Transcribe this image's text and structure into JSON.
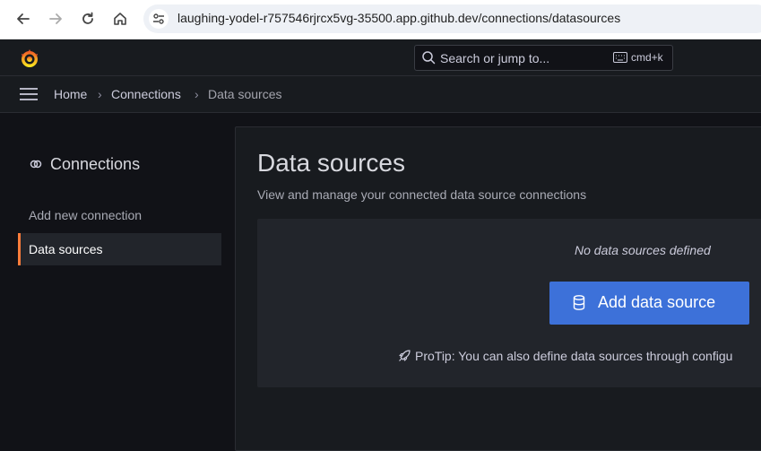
{
  "browser": {
    "url": "laughing-yodel-r757546rjrcx5vg-35500.app.github.dev/connections/datasources"
  },
  "topbar": {
    "search_placeholder": "Search or jump to...",
    "shortcut": "cmd+k"
  },
  "breadcrumb": {
    "items": [
      "Home",
      "Connections",
      "Data sources"
    ]
  },
  "sidebar": {
    "title": "Connections",
    "items": [
      {
        "label": "Add new connection",
        "active": false
      },
      {
        "label": "Data sources",
        "active": true
      }
    ]
  },
  "main": {
    "title": "Data sources",
    "subtitle": "View and manage your connected data source connections",
    "empty_message": "No data sources defined",
    "add_button_label": "Add data source",
    "protip": "ProTip: You can also define data sources through configu"
  },
  "colors": {
    "accent_active": "#ff7d3b",
    "primary_button": "#3d71d9"
  }
}
